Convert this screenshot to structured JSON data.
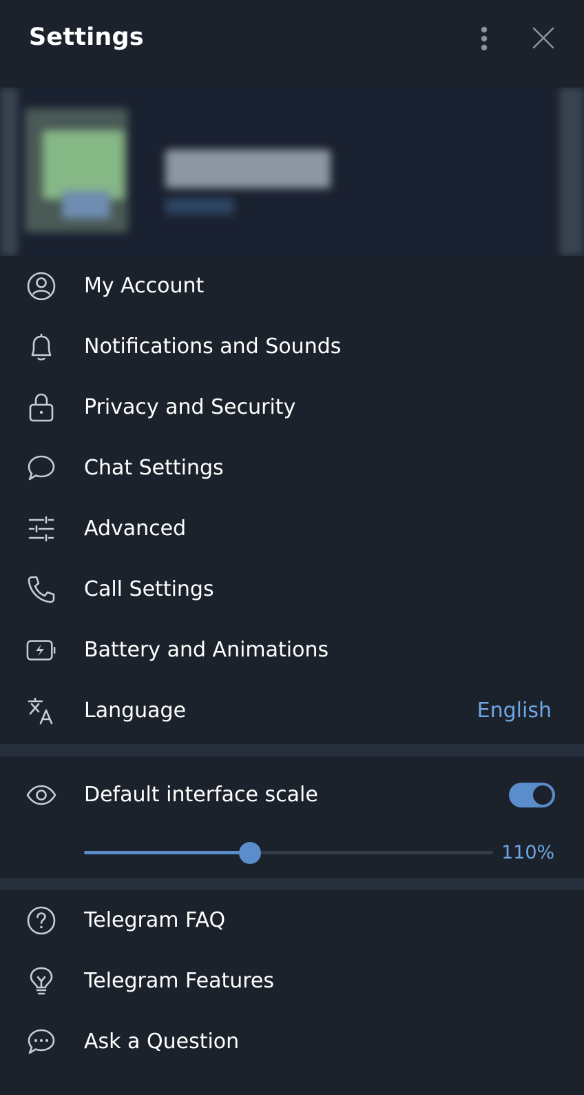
{
  "header": {
    "title": "Settings"
  },
  "menu": {
    "items": [
      {
        "label": "My Account",
        "icon": "account-circle-icon"
      },
      {
        "label": "Notifications and Sounds",
        "icon": "bell-icon"
      },
      {
        "label": "Privacy and Security",
        "icon": "lock-icon"
      },
      {
        "label": "Chat Settings",
        "icon": "chat-bubble-icon"
      },
      {
        "label": "Advanced",
        "icon": "sliders-icon"
      },
      {
        "label": "Call Settings",
        "icon": "phone-icon"
      },
      {
        "label": "Battery and Animations",
        "icon": "battery-bolt-icon"
      },
      {
        "label": "Language",
        "icon": "translate-icon",
        "value": "English"
      }
    ]
  },
  "scale": {
    "label": "Default interface scale",
    "icon": "eye-icon",
    "enabled": true,
    "value_text": "110%",
    "slider_fraction": 0.405
  },
  "help": {
    "items": [
      {
        "label": "Telegram FAQ",
        "icon": "question-circle-icon"
      },
      {
        "label": "Telegram Features",
        "icon": "lightbulb-icon"
      },
      {
        "label": "Ask a Question",
        "icon": "chat-dots-icon"
      }
    ]
  },
  "colors": {
    "background": "#1c222c",
    "accent": "#5b8dcc",
    "link": "#6ea6e5",
    "divider": "#252e3a"
  }
}
